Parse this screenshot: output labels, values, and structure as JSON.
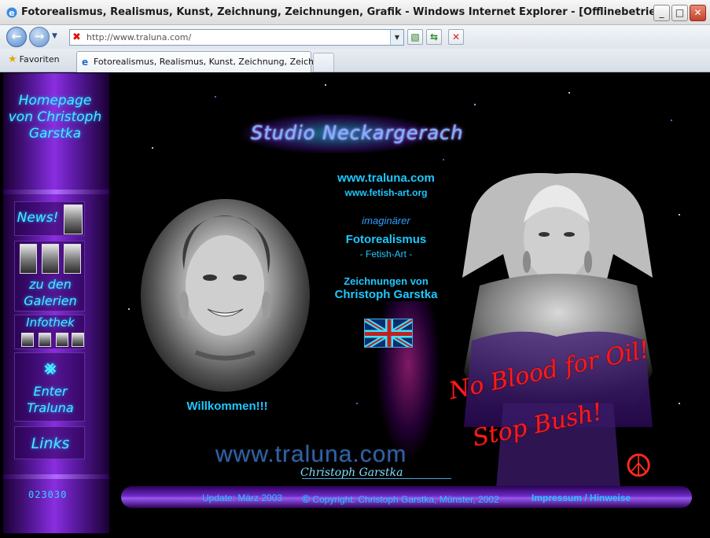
{
  "window": {
    "title": "Fotorealismus, Realismus, Kunst, Zeichnung, Zeichnungen, Grafik - Windows Internet Explorer - [Offlinebetrieb]",
    "minimize": "_",
    "maximize": "□",
    "close": "✕"
  },
  "nav": {
    "address": "http://www.traluna.com/"
  },
  "tabs": {
    "favorites_label": "Favoriten",
    "active_tab_label": "Fotorealismus, Realismus, Kunst, Zeichnung, Zeichnu..."
  },
  "sidebar": {
    "homepage_label": "Homepage von Christoph Garstka",
    "news_label": "News!",
    "galleries_label": "zu den Galerien",
    "infothek_label": "Infothek",
    "enter_label": "Enter Traluna",
    "links_label": "Links",
    "counter": "023030"
  },
  "center": {
    "studio_label": "Studio Neckargerach",
    "url_primary": "www.traluna.com",
    "url_secondary": "www.fetish-art.org",
    "imaginary_label": "imaginärer",
    "fotorealismus_label": "Fotorealismus",
    "fetish_art_label": "- Fetish-Art -",
    "drawings_by_label": "Zeichnungen von",
    "artist_name": "Christoph Garstka"
  },
  "left_portrait": {
    "welcome_text": "Willkommen!!!"
  },
  "right_art": {
    "slogan_line1": "No Blood for Oil!",
    "slogan_line2": "Stop Bush!"
  },
  "watermark": {
    "url": "www.traluna.com",
    "signature": "Christoph Garstka"
  },
  "footer": {
    "update_text": "Update: März 2003",
    "copyright_symbol": "©",
    "copyright_text": "Copyright: Christoph Garstka, Münster, 2002",
    "impressum_link": "Impressum / Hinweise"
  },
  "colors": {
    "accent_cyan": "#1ec8ff",
    "sidebar_purple": "#8a2ee0",
    "slogan_red": "#ff1a1a"
  }
}
